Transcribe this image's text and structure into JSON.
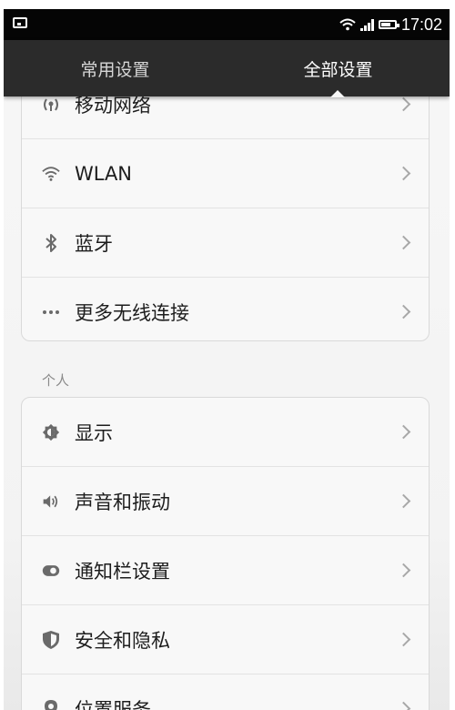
{
  "status_bar": {
    "time": "17:02"
  },
  "tabs": [
    {
      "label": "常用设置",
      "selected": false
    },
    {
      "label": "全部设置",
      "selected": true
    }
  ],
  "network_items": [
    {
      "label": "移动网络",
      "icon": "mobile-network-icon"
    },
    {
      "label": "WLAN",
      "icon": "wifi-icon"
    },
    {
      "label": "蓝牙",
      "icon": "bluetooth-icon"
    },
    {
      "label": "更多无线连接",
      "icon": "more-dots-icon"
    }
  ],
  "personal": {
    "header": "个人",
    "items": [
      {
        "label": "显示",
        "icon": "brightness-icon"
      },
      {
        "label": "声音和振动",
        "icon": "speaker-icon"
      },
      {
        "label": "通知栏设置",
        "icon": "toggle-icon"
      },
      {
        "label": "安全和隐私",
        "icon": "shield-icon"
      },
      {
        "label": "位置服务",
        "icon": "location-pin-icon"
      }
    ]
  },
  "colors": {
    "status_bar_bg": "#050505",
    "tab_bar_bg": "#2b2b2b",
    "card_bg": "#f8f8f8",
    "icon_color": "#6a6a6a"
  }
}
